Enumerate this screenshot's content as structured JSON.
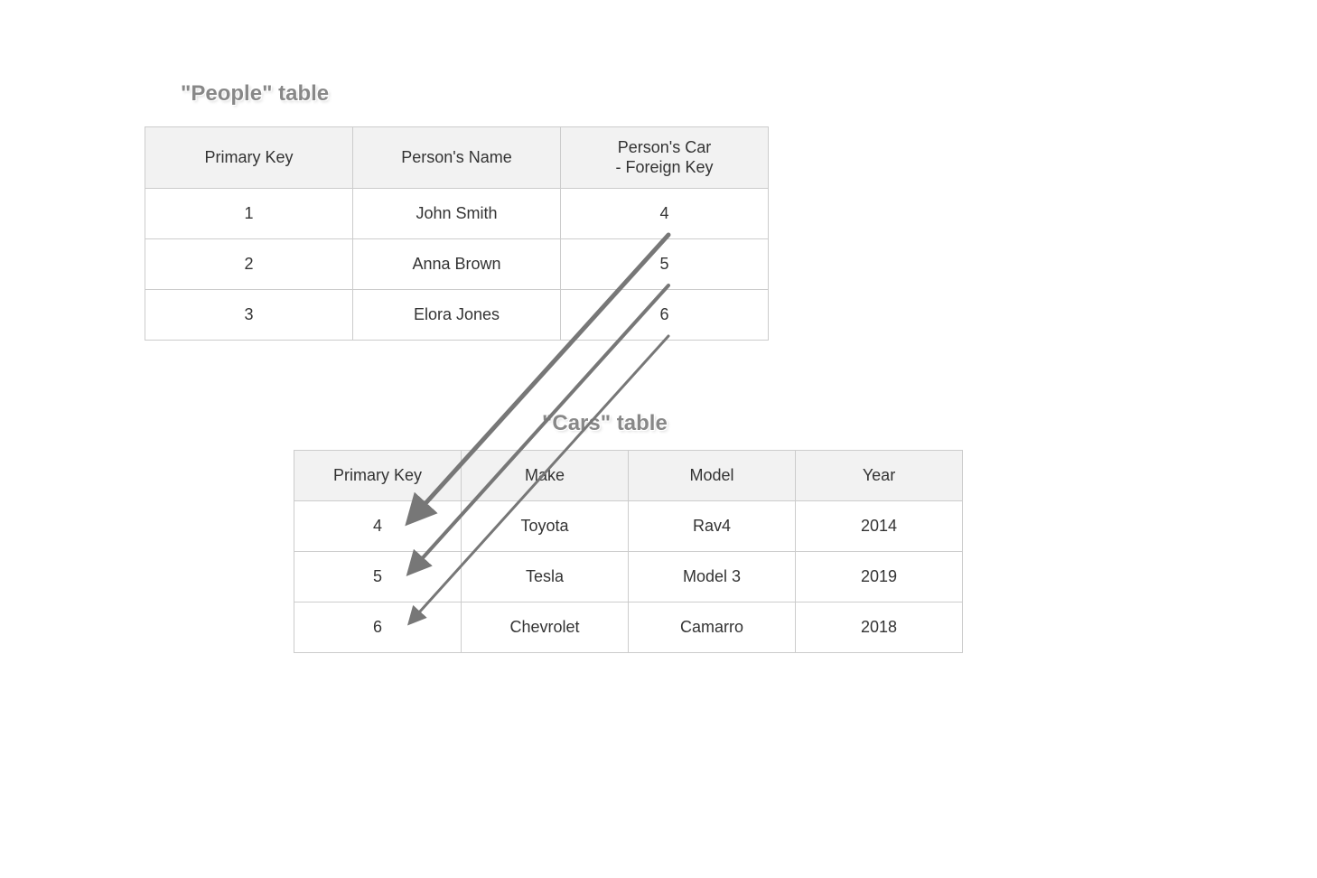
{
  "people": {
    "title": "\"People\" table",
    "headers": [
      "Primary Key",
      "Person's Name",
      "Person's Car - Foreign Key"
    ],
    "rows": [
      {
        "pk": "1",
        "name": "John Smith",
        "fk": "4"
      },
      {
        "pk": "2",
        "name": "Anna Brown",
        "fk": "5"
      },
      {
        "pk": "3",
        "name": "Elora Jones",
        "fk": "6"
      }
    ]
  },
  "cars": {
    "title": "\"Cars\" table",
    "headers": [
      "Primary Key",
      "Make",
      "Model",
      "Year"
    ],
    "rows": [
      {
        "pk": "4",
        "make": "Toyota",
        "model": "Rav4",
        "year": "2014"
      },
      {
        "pk": "5",
        "make": "Tesla",
        "model": "Model 3",
        "year": "2019"
      },
      {
        "pk": "6",
        "make": "Chevrolet",
        "model": "Camarro",
        "year": "2018"
      }
    ]
  },
  "relationships": [
    {
      "from_fk": "4",
      "to_pk": "4"
    },
    {
      "from_fk": "5",
      "to_pk": "5"
    },
    {
      "from_fk": "6",
      "to_pk": "6"
    }
  ]
}
